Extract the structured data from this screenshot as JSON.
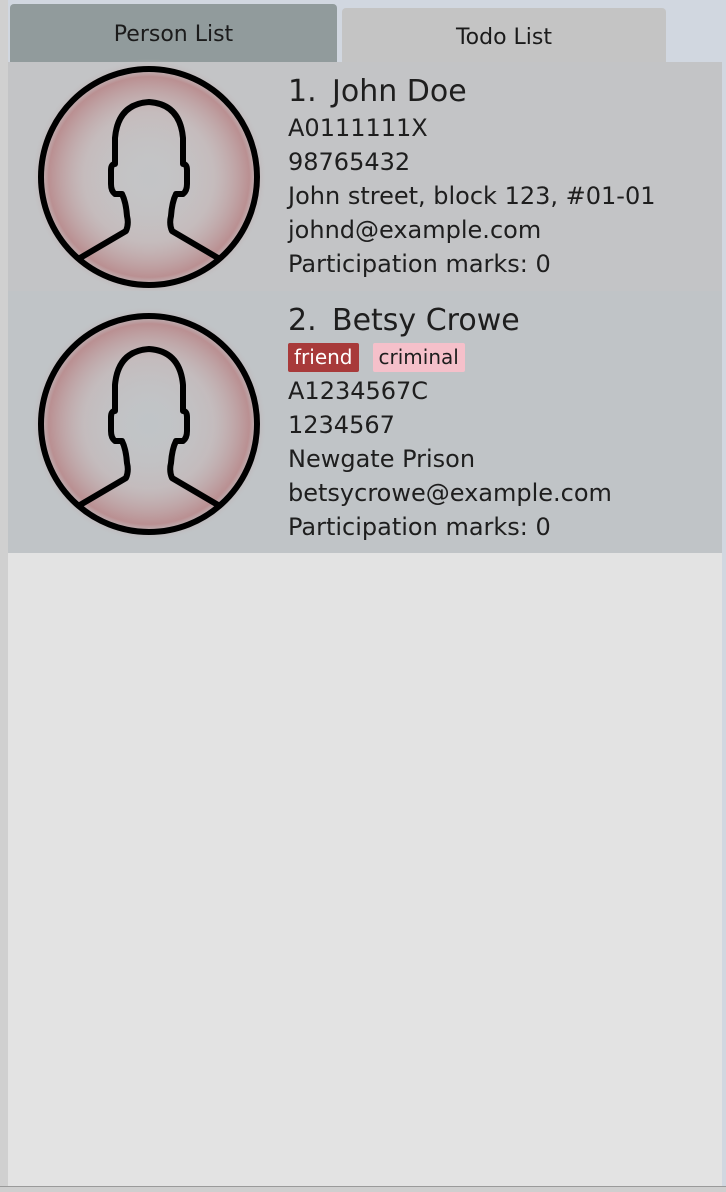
{
  "tabs": [
    {
      "label": "Person List",
      "selected": true
    },
    {
      "label": "Todo List",
      "selected": false
    }
  ],
  "persons": [
    {
      "index": "1.",
      "name": "John Doe",
      "tags": [],
      "id": "A0111111X",
      "phone": "98765432",
      "address": "John street, block 123, #01-01",
      "email": "johnd@example.com",
      "participation": "Participation marks: 0"
    },
    {
      "index": "2.",
      "name": "Betsy Crowe",
      "tags": [
        {
          "label": "friend",
          "bg": "#a83a3a",
          "fg": "#ffffff"
        },
        {
          "label": "criminal",
          "bg": "#f5c0ca",
          "fg": "#1e1e1e"
        }
      ],
      "id": "A1234567C",
      "phone": "1234567",
      "address": "Newgate Prison",
      "email": "betsycrowe@example.com",
      "participation": "Participation marks: 0"
    }
  ],
  "colors": {
    "selected_tab": "#919b9c",
    "unselected_tab": "#c4c4c4",
    "card_bg": "#c3c4c6",
    "list_bg": "#e3e3e3"
  },
  "icons": {
    "avatar": "person-silhouette-icon"
  }
}
